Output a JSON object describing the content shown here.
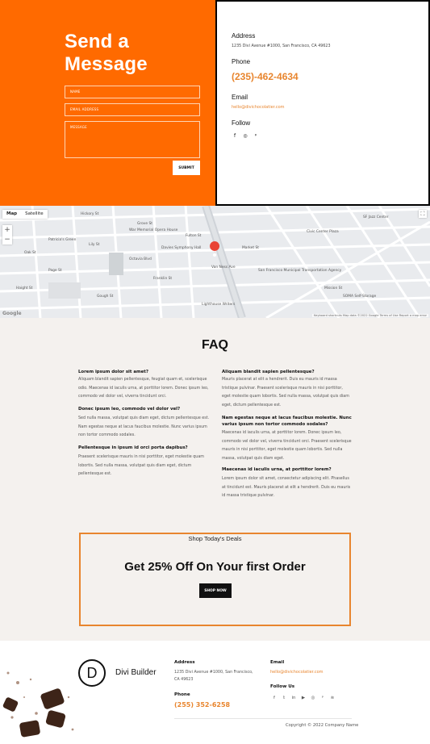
{
  "hero": {
    "title": "Send a Message",
    "fields": {
      "name": "NAME",
      "email": "EMAIL ADDRESS",
      "message": "MESSAGE"
    },
    "submit": "SUBMIT"
  },
  "contact": {
    "address_label": "Address",
    "address": "1235 Divi Avenue #1000, San Francisco, CA 49623",
    "phone_label": "Phone",
    "phone": "(235)-462-4634",
    "email_label": "Email",
    "email": "hello@divichocolatier.com",
    "follow_label": "Follow",
    "social_icons": [
      "facebook-icon",
      "instagram-icon",
      "pinterest-icon"
    ]
  },
  "map": {
    "tabs": [
      "Map",
      "Satellite"
    ],
    "zoom_in": "+",
    "zoom_out": "−",
    "labels": [
      "Hickory St",
      "Grove St",
      "Fulton St",
      "Lily St",
      "Oak St",
      "Page St",
      "Haight St",
      "Van Ness Ave",
      "Market St",
      "Mission St",
      "Octavia Blvd",
      "Franklin St",
      "Gough St",
      "SF Jazz Center",
      "Civic Center Plaza",
      "War Memorial Opera House",
      "Davies Symphony Hall",
      "San Francisco Municipal Transportation Agency",
      "SOMA Self-Storage",
      "Lighthouse Writers",
      "Patricia's Green"
    ],
    "footer": "Keyboard shortcuts   Map data ©2022 Google   Terms of Use   Report a map error",
    "logo": "Google"
  },
  "faq": {
    "title": "FAQ",
    "left": [
      {
        "q": "Lorem ipsum dolor sit amet?",
        "a": "Aliquam blandit sapien pellentesque, feugiat quam et, scelerisque odio. Maecenas id iaculis urna, at porttitor lorem. Donec ipsum leo, commodo vel dolor vel, viverra tincidunt orci."
      },
      {
        "q": "Donec ipsum leo, commodo vel dolor vel?",
        "a": "Sed nulla massa, volutpat quis diam eget, dictum pellentesque est. Nam egestas neque at lacus faucibus molestie. Nunc varius ipsum non tortor commodo sodales."
      },
      {
        "q": "Pellentesque in ipsum id orci porta dapibus?",
        "a": "Praesent scelerisque mauris in nisi porttitor, eget molestie quam lobortis. Sed nulla massa, volutpat quis diam eget, dictum pellentesque est."
      }
    ],
    "right": [
      {
        "q": "Aliquam blandit sapien pellentesque?",
        "a": "Mauris placerat at elit a hendrerit. Duis eu mauris id massa tristique pulvinar. Praesent scelerisque mauris in nisi porttitor, eget molestie quam lobortis. Sed nulla massa, volutpat quis diam eget, dictum pellentesque est."
      },
      {
        "q": "Nam egestas neque at lacus faucibus molestie. Nunc varius ipsum non tortor commodo sodales?",
        "a": "Maecenas id iaculis urna, at porttitor lorem. Donec ipsum leo, commodo vel dolor vel, viverra tincidunt orci. Praesent scelerisque mauris in nisi porttitor, eget molestie quam lobortis. Sed nulla massa, volutpat quis diam eget."
      },
      {
        "q": "Maecenas id iaculis urna, at porttitor lorem?",
        "a": "Lorem ipsum dolor sit amet, consectetur adipiscing elit. Phasellus at tincidunt est. Mauris placerat at elit a hendrerit. Duis eu mauris id massa tristique pulvinar."
      }
    ]
  },
  "deals": {
    "label": "Shop Today's Deals",
    "title": "Get 25% Off On Your first Order",
    "button": "SHOP NOW"
  },
  "footer": {
    "logo_letter": "D",
    "brand": "Divi Builder",
    "address_label": "Address",
    "address": "1235 Divi Avenue #1000, San Francisco, CA 49623",
    "phone_label": "Phone",
    "phone": "(255) 352-6258",
    "email_label": "Email",
    "email": "hello@divichocolatier.com",
    "follow_label": "Follow Us",
    "social_icons": [
      "facebook-icon",
      "twitter-icon",
      "linkedin-icon",
      "youtube-icon",
      "instagram-icon",
      "pinterest-icon",
      "rss-icon"
    ],
    "copyright": "Copyright © 2022 Company Name"
  },
  "colors": {
    "orange": "#ff6a00",
    "accent": "#e8852e",
    "background": "#f4f1ee"
  }
}
